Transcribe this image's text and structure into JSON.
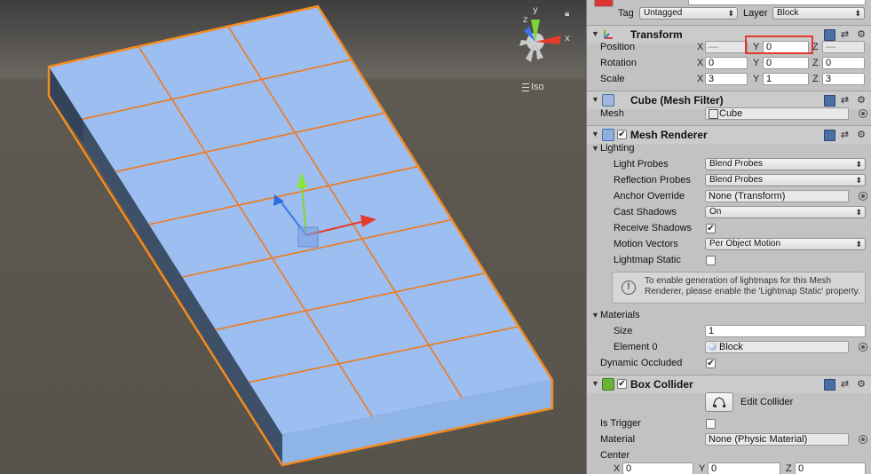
{
  "scene": {
    "view_mode_label": "Iso",
    "gizmo_axes": {
      "x": "x",
      "y": "y",
      "z": "z"
    }
  },
  "inspector": {
    "tag_label": "Tag",
    "tag_value": "Untagged",
    "layer_label": "Layer",
    "layer_value": "Block",
    "transform": {
      "title": "Transform",
      "position": {
        "label": "Position",
        "x": "—",
        "y": "0",
        "z": "—"
      },
      "rotation": {
        "label": "Rotation",
        "x": "0",
        "y": "0",
        "z": "0"
      },
      "scale": {
        "label": "Scale",
        "x": "3",
        "y": "1",
        "z": "3"
      }
    },
    "mesh_filter": {
      "title": "Cube (Mesh Filter)",
      "mesh_label": "Mesh",
      "mesh_value": "Cube"
    },
    "mesh_renderer": {
      "title": "Mesh Renderer",
      "lighting_label": "Lighting",
      "light_probes": {
        "label": "Light Probes",
        "value": "Blend Probes"
      },
      "reflection_probes": {
        "label": "Reflection Probes",
        "value": "Blend Probes"
      },
      "anchor_override": {
        "label": "Anchor Override",
        "value": "None (Transform)"
      },
      "cast_shadows": {
        "label": "Cast Shadows",
        "value": "On"
      },
      "receive_shadows": {
        "label": "Receive Shadows",
        "checked": true
      },
      "motion_vectors": {
        "label": "Motion Vectors",
        "value": "Per Object Motion"
      },
      "lightmap_static": {
        "label": "Lightmap Static",
        "checked": false
      },
      "help_text": "To enable generation of lightmaps for this Mesh Renderer, please enable the 'Lightmap Static' property.",
      "materials_label": "Materials",
      "size": {
        "label": "Size",
        "value": "1"
      },
      "element0": {
        "label": "Element 0",
        "value": "Block"
      },
      "dynamic_occluded": {
        "label": "Dynamic Occluded",
        "checked": true
      }
    },
    "box_collider": {
      "title": "Box Collider",
      "edit_collider_label": "Edit Collider",
      "is_trigger": {
        "label": "Is Trigger",
        "checked": false
      },
      "material": {
        "label": "Material",
        "value": "None (Physic Material)"
      },
      "center": {
        "label": "Center",
        "x": "0",
        "y": "0",
        "z": "0"
      }
    },
    "axis_labels": {
      "x": "X",
      "y": "Y",
      "z": "Z"
    },
    "check_mark": "✔"
  },
  "colors": {
    "tile_fill": "#9cbef0",
    "tile_grid": "#f07a1c",
    "selection_outline": "#f58a1e",
    "side_dark": "#3d4f66",
    "sky": "#4e4d4b",
    "ground": "#6e6658",
    "highlight_box": "#e0392b"
  }
}
